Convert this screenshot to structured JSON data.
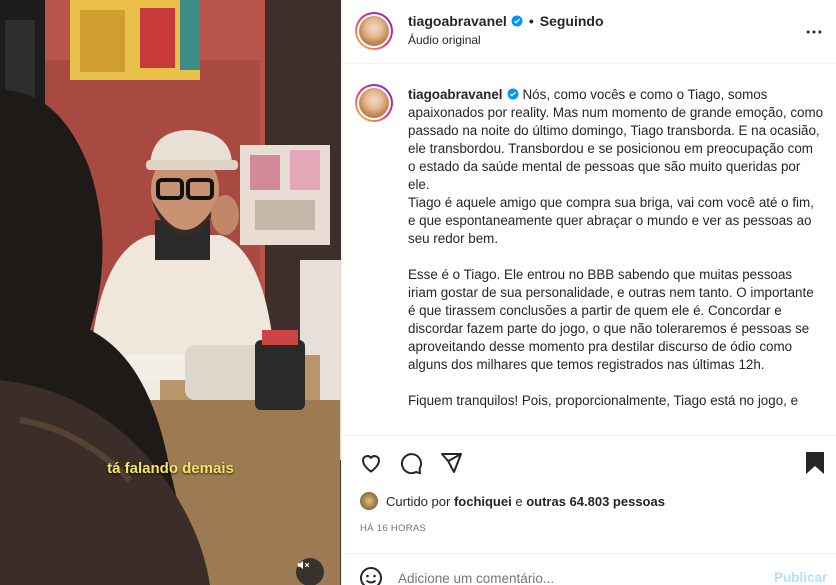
{
  "video": {
    "subtitle": "tá falando demais",
    "mute_icon": "speaker-muted-icon"
  },
  "header": {
    "username": "tiagoabravanel",
    "separator": "•",
    "follow_status": "Seguindo",
    "audio": "Áudio original",
    "more_icon": "more-horizontal-icon"
  },
  "caption": {
    "username": "tiagoabravanel",
    "paragraphs": [
      "Nós, como vocês e como o Tiago, somos apaixonados por reality. Mas num momento de grande emoção, como passado na noite do último domingo, Tiago transborda. E na ocasião, ele transbordou. Transbordou e se posicionou em preocupação com o estado da saúde mental de pessoas que são muito queridas por ele.",
      "Tiago é aquele amigo que compra sua briga, vai com você até o fim, e que espontaneamente quer abraçar o mundo e ver as pessoas ao seu redor bem.",
      "Esse é o Tiago. Ele entrou no BBB sabendo que muitas pessoas iriam gostar de sua personalidade, e outras nem tanto. O importante é que tirassem conclusões a partir de quem ele é. Concordar e discordar fazem parte do jogo, o que não toleraremos é pessoas se aproveitando desse momento pra destilar discurso de ódio como alguns dos milhares que temos registrados nas últimas 12h.",
      "Fiquem tranquilos! Pois, proporcionalmente, Tiago está no jogo, e"
    ]
  },
  "actions": {
    "like_icon": "heart-icon",
    "comment_icon": "comment-icon",
    "share_icon": "send-icon",
    "save_icon": "bookmark-icon"
  },
  "likes": {
    "prefix": "Curtido por",
    "user": "fochiquei",
    "connector": "e",
    "others": "outras 64.803 pessoas"
  },
  "timestamp": "HÁ 16 HORAS",
  "comment": {
    "emoji_icon": "emoji-icon",
    "placeholder": "Adicione um comentário...",
    "publish": "Publicar"
  },
  "colors": {
    "verified": "#0095f6",
    "publish_disabled": "#b2dffc",
    "subtitle": "#f5e663"
  }
}
